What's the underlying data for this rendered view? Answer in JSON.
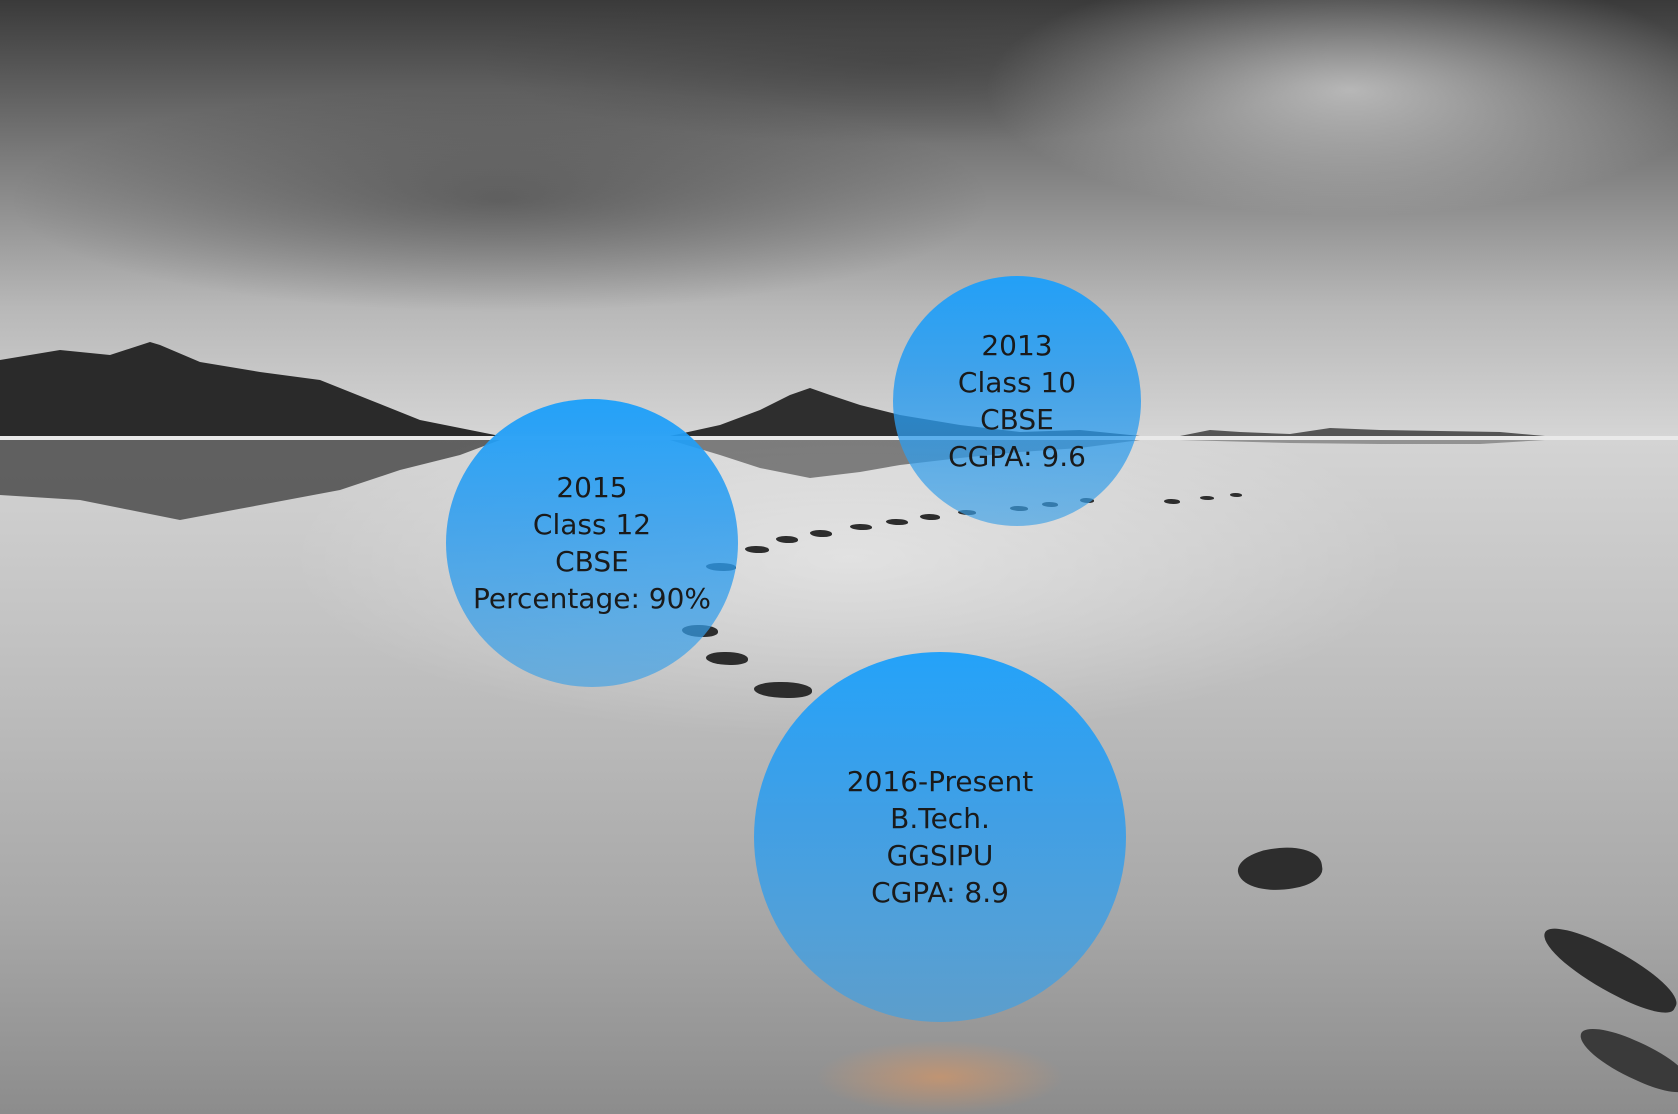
{
  "colors": {
    "bubble_blue": "#1ea0fa",
    "text": "#1a1a1a"
  },
  "education": [
    {
      "year": "2013",
      "level": "Class 10",
      "board": "CBSE",
      "score": "CGPA: 9.6"
    },
    {
      "year": "2015",
      "level": "Class 12",
      "board": "CBSE",
      "score": "Percentage: 90%"
    },
    {
      "year": "2016-Present",
      "level": "B.Tech.",
      "board": "GGSIPU",
      "score": "CGPA: 8.9"
    }
  ]
}
